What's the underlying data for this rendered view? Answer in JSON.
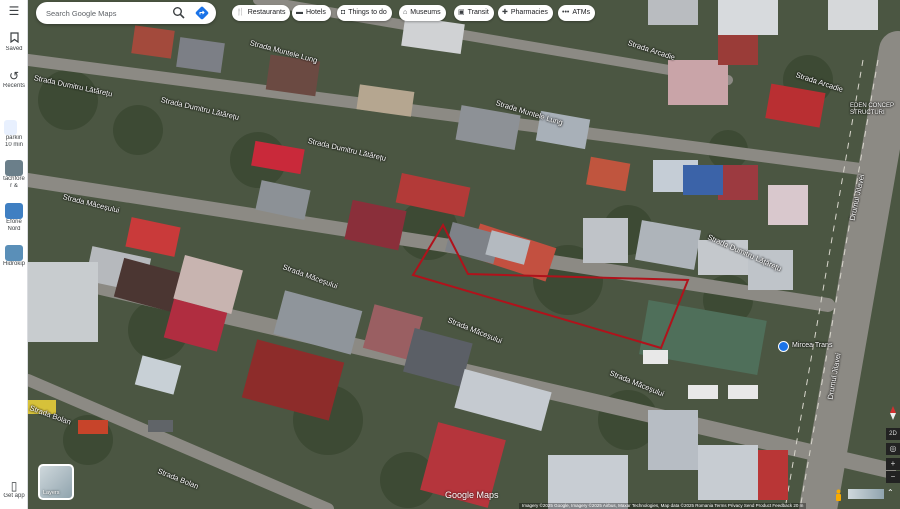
{
  "rail": {
    "menu_icon": "hamburger-icon",
    "saved_label": "Saved",
    "recents_label": "Recents",
    "item1_label": "pārkin\n10 min",
    "item1_line1": "pārkin",
    "item1_line2": "10 min",
    "item2_line1": "tachfore",
    "item2_line2": "r &",
    "item3_line1": "Eforie",
    "item3_line2": "Nord",
    "item4_label": "Hidrokip",
    "get_app_label": "Get app"
  },
  "search": {
    "placeholder": "Search Google Maps"
  },
  "chips": [
    {
      "label": "Restaurants",
      "icon": "fork-knife-icon"
    },
    {
      "label": "Hotels",
      "icon": "bed-icon"
    },
    {
      "label": "Things to do",
      "icon": "camera-icon"
    },
    {
      "label": "Museums",
      "icon": "museum-icon"
    },
    {
      "label": "Transit",
      "icon": "train-icon"
    },
    {
      "label": "Pharmacies",
      "icon": "pharmacy-icon"
    },
    {
      "label": "ATMs",
      "icon": "atm-icon"
    }
  ],
  "map": {
    "streets": [
      "Strada Muntele Lung",
      "Strada Muntele Lung",
      "Strada Dumitru Lătărețu",
      "Strada Dumitru Lătărețu",
      "Strada Dumitru Lătărețu",
      "Strada Dumitru Lățărețu",
      "Strada Măceșului",
      "Strada Măceșului",
      "Strada Măceșului",
      "Strada Măceșului",
      "Strada Arcadie",
      "Strada Arcadie",
      "Drumul Jilavei",
      "Drumul Jilavei",
      "Strada Bolan",
      "Strada Bolan"
    ],
    "poi_label": "Mircea Trans",
    "corner_label_1": "EDEN CONCEP",
    "corner_label_2": "STRUCTURI"
  },
  "controls": {
    "layers_label": "Layers",
    "google_logo": "Google Maps",
    "attribution": "Imagery ©2025 Google, Imagery ©2025 Airbus, Maxar Technologies, Map data ©2025   Romania   Terms   Privacy   Send Product Feedback   20 m",
    "zoom_level": "2D",
    "zoom_in": "+",
    "zoom_out": "−"
  },
  "colors": {
    "boundary": "#b0121b",
    "poi_marker": "#1a73e8",
    "search_icon": "#1a73e8"
  }
}
